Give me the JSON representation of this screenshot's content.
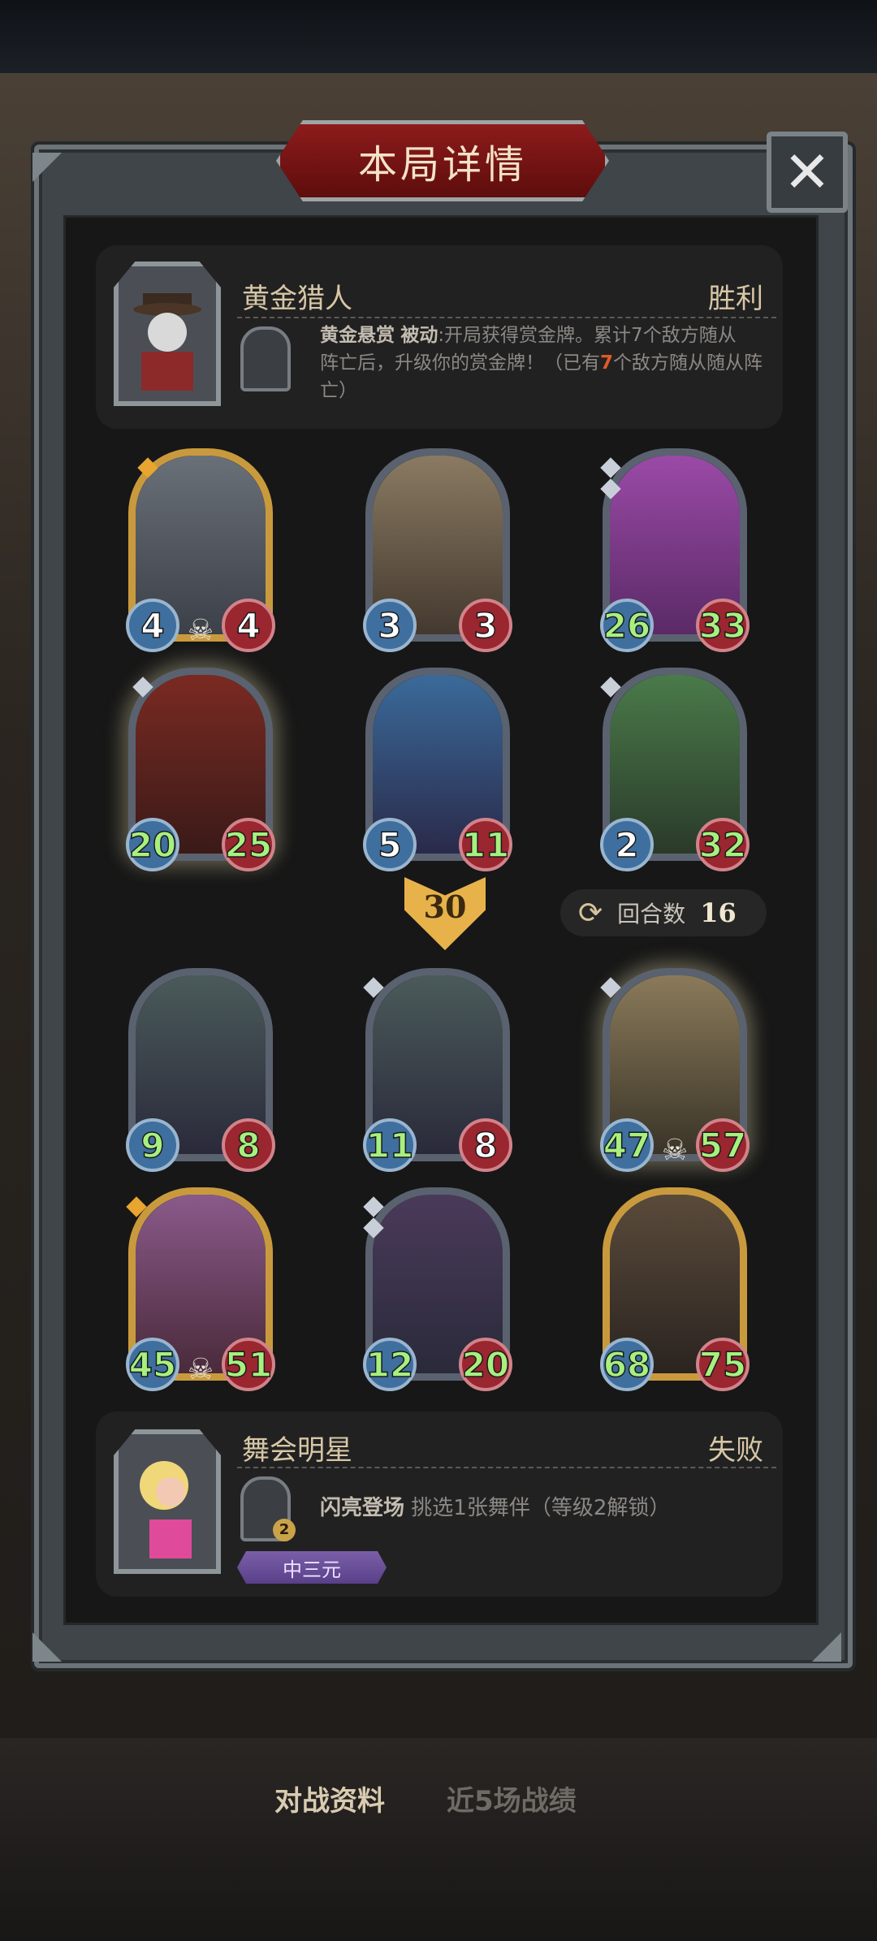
{
  "dialog": {
    "title": "本局详情",
    "close_label": "✕"
  },
  "top_hero": {
    "name": "黄金猎人",
    "result": "胜利",
    "skill_name": "黄金悬赏",
    "skill_type": "被动",
    "skill_desc_1": ":开局获得赏金牌。累计7个敌方随从",
    "skill_desc_2": "阵亡后，升级你的赏金牌！（已有",
    "skill_count": "7",
    "skill_desc_3": "个敌方随从随从阵",
    "skill_desc_4": "亡）"
  },
  "top_cards": [
    {
      "attack": "4",
      "health": "4"
    },
    {
      "attack": "3",
      "health": "3"
    },
    {
      "attack": "26",
      "health": "33"
    },
    {
      "attack": "20",
      "health": "25"
    },
    {
      "attack": "5",
      "health": "11"
    },
    {
      "attack": "2",
      "health": "32"
    }
  ],
  "turn_badge": "30",
  "round": {
    "icon": "refresh-icon",
    "label": "回合数",
    "value": "16"
  },
  "bottom_cards": [
    {
      "attack": "9",
      "health": "8"
    },
    {
      "attack": "11",
      "health": "8"
    },
    {
      "attack": "47",
      "health": "57"
    },
    {
      "attack": "45",
      "health": "51"
    },
    {
      "attack": "12",
      "health": "20"
    },
    {
      "attack": "68",
      "health": "75"
    }
  ],
  "bottom_hero": {
    "name": "舞会明星",
    "result": "失败",
    "skill_name": "闪亮登场",
    "skill_desc": "挑选1张舞伴（等级2解锁）",
    "level": "2",
    "rank": "中三元"
  },
  "bottom_tabs": {
    "tab1": "对战资料",
    "tab2": "近5场战绩"
  },
  "colors": {
    "title_red": "#8d1b1b",
    "stat_buffed": "#a7f07f",
    "gold_frame": "#c99a3d"
  }
}
